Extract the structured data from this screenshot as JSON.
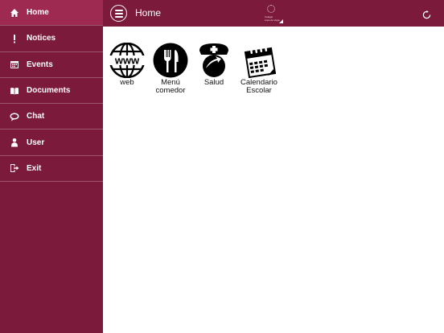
{
  "sidebar": {
    "items": [
      {
        "label": "Home",
        "icon": "home-icon"
      },
      {
        "label": "Notices",
        "icon": "exclamation-icon"
      },
      {
        "label": "Events",
        "icon": "calendar-icon"
      },
      {
        "label": "Documents",
        "icon": "book-icon"
      },
      {
        "label": "Chat",
        "icon": "chat-icon"
      },
      {
        "label": "User",
        "icon": "user-icon"
      },
      {
        "label": "Exit",
        "icon": "exit-icon"
      }
    ],
    "active": "Home"
  },
  "header": {
    "title": "Home",
    "logo_line1": "Colegio",
    "logo_line2": "Lope de Vega",
    "menu_icon": "hamburger-menu-icon",
    "refresh_icon": "refresh-icon"
  },
  "tiles": [
    {
      "label": "web",
      "icon": "www-globe-icon"
    },
    {
      "label": "Menú\ncomedor",
      "icon": "fork-knife-icon"
    },
    {
      "label": "Salud",
      "icon": "nurse-cap-icon"
    },
    {
      "label": "Calendario\nEscolar",
      "icon": "school-calendar-icon"
    }
  ],
  "colors": {
    "brand": "#7b1a3b",
    "active": "#9e2a51",
    "background": "#ffffff"
  }
}
